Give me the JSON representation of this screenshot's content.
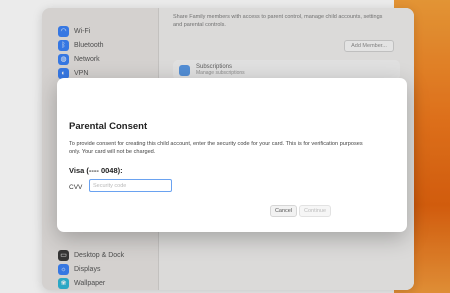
{
  "sidebar": {
    "items_top": [
      {
        "label": "Wi-Fi",
        "icon": "wifi-icon",
        "color": "#3b82f6"
      },
      {
        "label": "Bluetooth",
        "icon": "bluetooth-icon",
        "color": "#3b82f6"
      },
      {
        "label": "Network",
        "icon": "network-icon",
        "color": "#3b82f6"
      },
      {
        "label": "VPN",
        "icon": "vpn-icon",
        "color": "#3b82f6"
      }
    ],
    "items_bottom": [
      {
        "label": "Desktop & Dock",
        "icon": "dock-icon",
        "color": "#3a3a3a"
      },
      {
        "label": "Displays",
        "icon": "display-icon",
        "color": "#3b82f6"
      },
      {
        "label": "Wallpaper",
        "icon": "wallpaper-icon",
        "color": "#2fb6d6"
      }
    ]
  },
  "main": {
    "description": "Share Family members with access to parent control, manage child accounts, settings and parental controls.",
    "add_member_label": "Add Member...",
    "subscription_title": "Subscriptions",
    "subscription_desc": "Manage subscriptions"
  },
  "dialog": {
    "title": "Parental Consent",
    "body": "To provide consent for creating this child account, enter the security code for your card. This is for verification purposes only. Your card will not be charged.",
    "card_label": "Visa (---- 0048):",
    "cvv_label": "CVV",
    "cvv_placeholder": "Security code",
    "cancel_label": "Cancel",
    "continue_label": "Continue"
  }
}
